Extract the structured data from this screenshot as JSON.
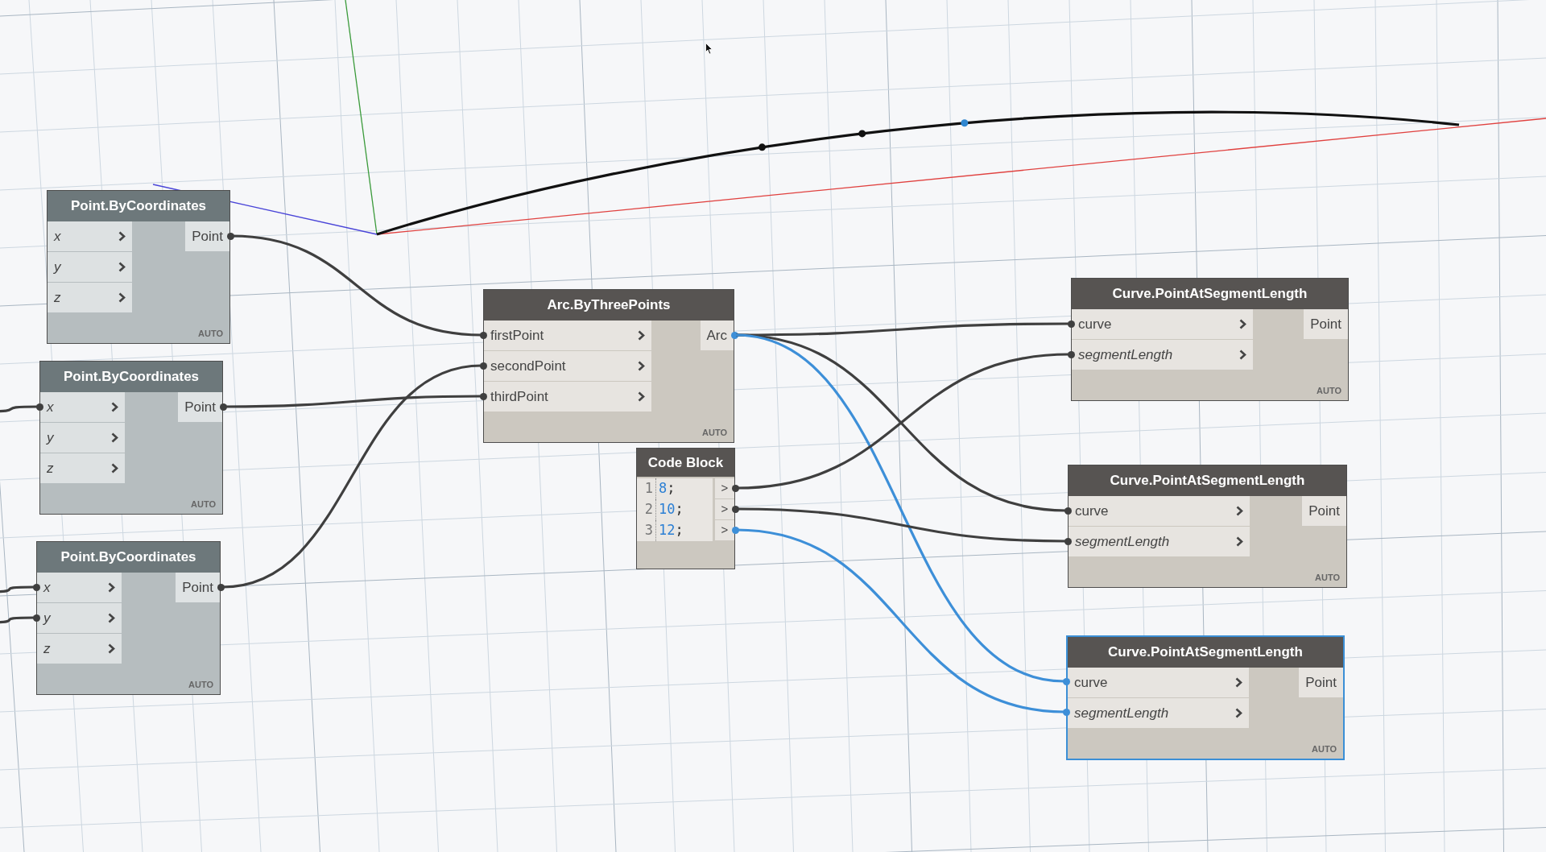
{
  "nodes": [
    {
      "kind": "function",
      "title": "Point.ByCoordinates",
      "preview": false,
      "selected": false,
      "inputs": [
        {
          "label": "x",
          "default": true
        },
        {
          "label": "y",
          "default": true
        },
        {
          "label": "z",
          "default": true
        }
      ],
      "outputs": [
        "Point"
      ],
      "lacing": "AUTO"
    },
    {
      "kind": "function",
      "title": "Point.ByCoordinates",
      "preview": false,
      "selected": false,
      "inputs": [
        {
          "label": "x",
          "default": true
        },
        {
          "label": "y",
          "default": true
        },
        {
          "label": "z",
          "default": true
        }
      ],
      "outputs": [
        "Point"
      ],
      "lacing": "AUTO"
    },
    {
      "kind": "function",
      "title": "Point.ByCoordinates",
      "preview": false,
      "selected": false,
      "inputs": [
        {
          "label": "x",
          "default": true
        },
        {
          "label": "y",
          "default": true
        },
        {
          "label": "z",
          "default": true
        }
      ],
      "outputs": [
        "Point"
      ],
      "lacing": "AUTO"
    },
    {
      "kind": "function",
      "title": "Arc.ByThreePoints",
      "preview": true,
      "selected": false,
      "inputs": [
        {
          "label": "firstPoint",
          "default": false
        },
        {
          "label": "secondPoint",
          "default": false
        },
        {
          "label": "thirdPoint",
          "default": false
        }
      ],
      "outputs": [
        "Arc"
      ],
      "lacing": "AUTO"
    },
    {
      "kind": "code_block",
      "title": "Code Block",
      "preview": true,
      "selected": false,
      "lines": [
        {
          "number": "1",
          "tokens": [
            {
              "text": "8",
              "kind": "number"
            },
            {
              "text": ";",
              "kind": "punctuation"
            }
          ],
          "output": ">"
        },
        {
          "number": "2",
          "tokens": [
            {
              "text": "10",
              "kind": "number"
            },
            {
              "text": ";",
              "kind": "punctuation"
            }
          ],
          "output": ">"
        },
        {
          "number": "3",
          "tokens": [
            {
              "text": "12",
              "kind": "number"
            },
            {
              "text": ";",
              "kind": "punctuation"
            }
          ],
          "output": ">"
        }
      ]
    },
    {
      "kind": "function",
      "title": "Curve.PointAtSegmentLength",
      "preview": true,
      "selected": false,
      "inputs": [
        {
          "label": "curve",
          "default": false
        },
        {
          "label": "segmentLength",
          "default": true
        }
      ],
      "outputs": [
        "Point"
      ],
      "lacing": "AUTO"
    },
    {
      "kind": "function",
      "title": "Curve.PointAtSegmentLength",
      "preview": true,
      "selected": false,
      "inputs": [
        {
          "label": "curve",
          "default": false
        },
        {
          "label": "segmentLength",
          "default": true
        }
      ],
      "outputs": [
        "Point"
      ],
      "lacing": "AUTO"
    },
    {
      "kind": "function",
      "title": "Curve.PointAtSegmentLength",
      "preview": true,
      "selected": true,
      "inputs": [
        {
          "label": "curve",
          "default": false
        },
        {
          "label": "segmentLength",
          "default": true
        }
      ],
      "outputs": [
        "Point"
      ],
      "lacing": "AUTO"
    }
  ]
}
